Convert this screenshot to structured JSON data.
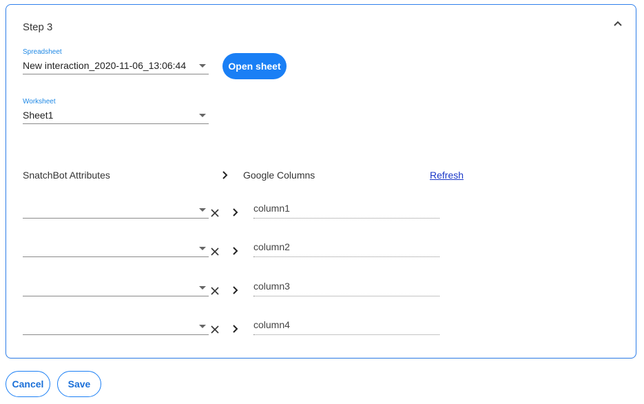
{
  "step": {
    "title": "Step 3"
  },
  "spreadsheet": {
    "label": "Spreadsheet",
    "value": "New interaction_2020-11-06_13:06:44",
    "open_button": "Open sheet"
  },
  "worksheet": {
    "label": "Worksheet",
    "value": "Sheet1"
  },
  "mapping": {
    "left_header": "SnatchBot Attributes",
    "right_header": "Google Columns",
    "refresh": "Refresh",
    "rows": [
      {
        "attribute": "",
        "column": "column1"
      },
      {
        "attribute": "",
        "column": "column2"
      },
      {
        "attribute": "",
        "column": "column3"
      },
      {
        "attribute": "",
        "column": "column4"
      }
    ]
  },
  "footer": {
    "cancel": "Cancel",
    "save": "Save"
  },
  "colors": {
    "accent": "#1a7ff5",
    "border": "#2f80ed",
    "link": "#1a37c8"
  }
}
